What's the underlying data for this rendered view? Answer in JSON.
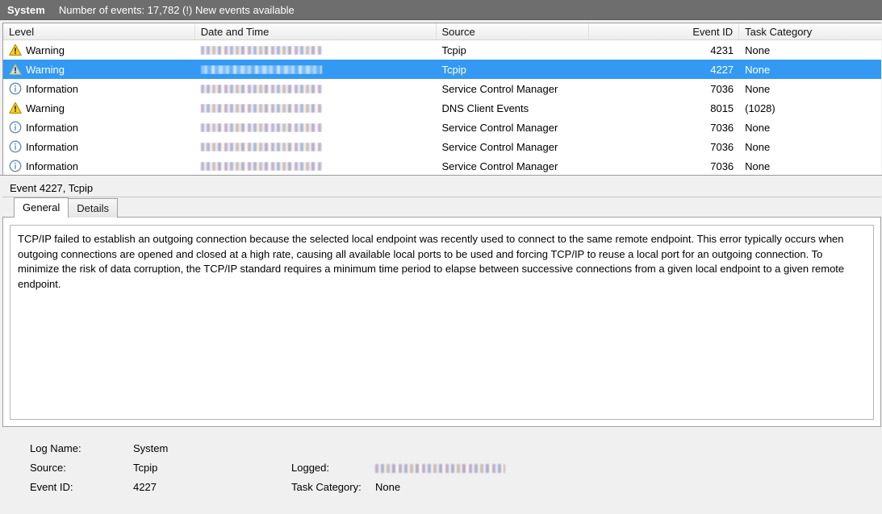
{
  "topbar": {
    "log_name": "System",
    "events_status": "Number of events: 17,782 (!) New events available"
  },
  "event_list": {
    "columns": [
      {
        "label": "Level",
        "align": "left"
      },
      {
        "label": "Date and Time",
        "align": "left"
      },
      {
        "label": "Source",
        "align": "left"
      },
      {
        "label": "Event ID",
        "align": "right"
      },
      {
        "label": "Task Category",
        "align": "left"
      }
    ],
    "rows": [
      {
        "icon": "warning-icon",
        "level": "Warning",
        "datetime": "",
        "source": "Tcpip",
        "event_id": "4231",
        "task_category": "None",
        "selected": false
      },
      {
        "icon": "warning-icon",
        "level": "Warning",
        "datetime": "",
        "source": "Tcpip",
        "event_id": "4227",
        "task_category": "None",
        "selected": true
      },
      {
        "icon": "information-icon",
        "level": "Information",
        "datetime": "",
        "source": "Service Control Manager",
        "event_id": "7036",
        "task_category": "None",
        "selected": false
      },
      {
        "icon": "warning-icon",
        "level": "Warning",
        "datetime": "",
        "source": "DNS Client Events",
        "event_id": "8015",
        "task_category": "(1028)",
        "selected": false
      },
      {
        "icon": "information-icon",
        "level": "Information",
        "datetime": "",
        "source": "Service Control Manager",
        "event_id": "7036",
        "task_category": "None",
        "selected": false
      },
      {
        "icon": "information-icon",
        "level": "Information",
        "datetime": "",
        "source": "Service Control Manager",
        "event_id": "7036",
        "task_category": "None",
        "selected": false
      },
      {
        "icon": "information-icon",
        "level": "Information",
        "datetime": "",
        "source": "Service Control Manager",
        "event_id": "7036",
        "task_category": "None",
        "selected": false
      }
    ]
  },
  "detail": {
    "title": "Event 4227, Tcpip",
    "tabs": [
      {
        "label": "General",
        "active": true
      },
      {
        "label": "Details",
        "active": false
      }
    ],
    "description": "TCP/IP failed to establish an outgoing connection because the selected local endpoint was recently used to connect to the same remote endpoint. This error typically occurs when outgoing connections are opened and closed at a high rate, causing all available local ports to be used and forcing TCP/IP to reuse a local port for an outgoing connection. To minimize the risk of data corruption, the TCP/IP standard requires a minimum time period to elapse between successive connections from a given local endpoint to a given remote endpoint.",
    "fields": {
      "log_name_label": "Log Name:",
      "log_name_value": "System",
      "source_label": "Source:",
      "source_value": "Tcpip",
      "logged_label": "Logged:",
      "logged_value": "",
      "event_id_label": "Event ID:",
      "event_id_value": "4227",
      "task_category_label": "Task Category:",
      "task_category_value": "None"
    }
  },
  "colors": {
    "selection_blue": "#3399f3",
    "topbar_gray": "#6e6e6e",
    "window_gray": "#f0f0f0",
    "warning_yellow": "#ffcc00",
    "info_blue": "#6e94b8"
  }
}
